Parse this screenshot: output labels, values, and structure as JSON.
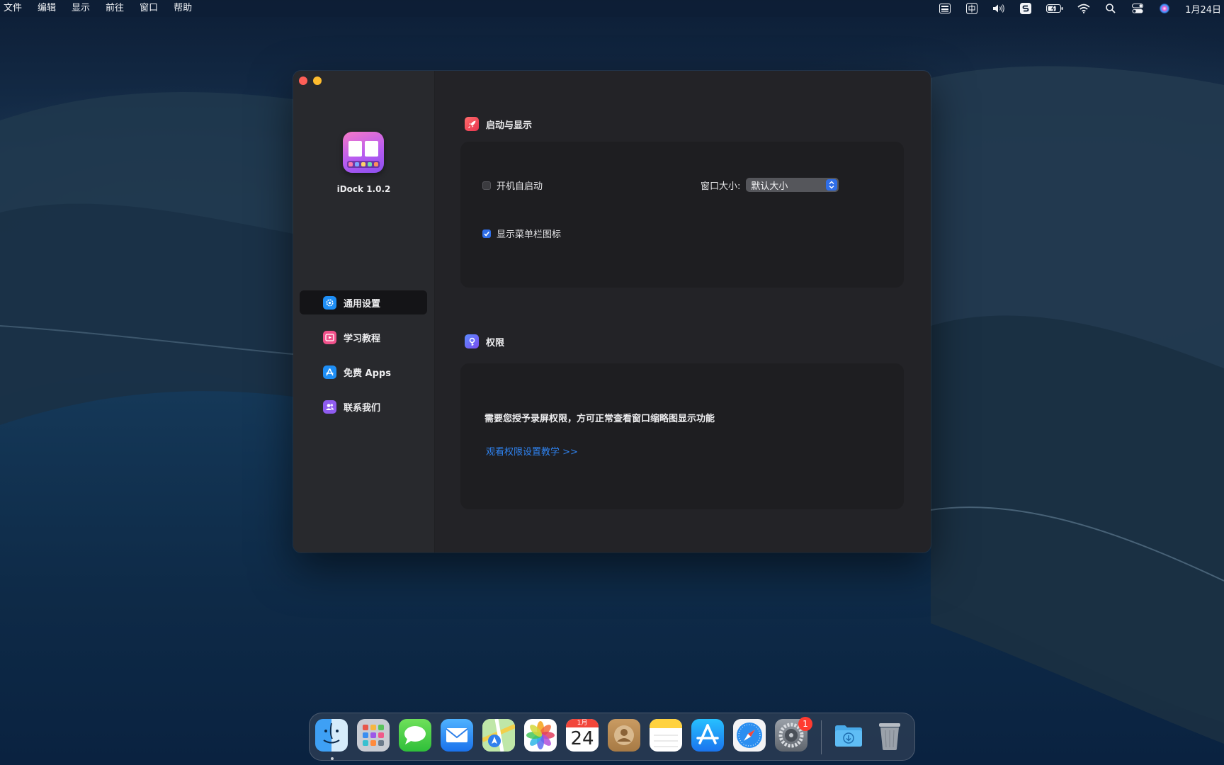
{
  "menubar": {
    "items": [
      "文件",
      "编辑",
      "显示",
      "前往",
      "窗口",
      "帮助"
    ],
    "status_icons": [
      "keyboard-grid-icon",
      "input-method-icon",
      "volume-icon",
      "sogou-icon",
      "battery-icon",
      "wifi-icon",
      "spotlight-search-icon",
      "control-center-icon",
      "siri-icon"
    ],
    "clock": "1月24日"
  },
  "window": {
    "app_name": "iDock 1.0.2",
    "nav": [
      {
        "label": "通用设置",
        "icon": "gear-icon",
        "active": true,
        "color": "#1e8ef5"
      },
      {
        "label": "学习教程",
        "icon": "tutorial-icon",
        "active": false,
        "color": "#f0508a"
      },
      {
        "label": "免费 Apps",
        "icon": "app-store-icon",
        "active": false,
        "color": "#1e8ef5"
      },
      {
        "label": "联系我们",
        "icon": "contacts-icon",
        "active": false,
        "color": "#8f5cf0"
      }
    ],
    "sections": {
      "launch": {
        "title": "启动与显示",
        "icon": "rocket-icon",
        "launch_at_login": {
          "label": "开机自启动",
          "checked": false
        },
        "window_size": {
          "label": "窗口大小:",
          "value": "默认大小"
        },
        "show_menubar_icon": {
          "label": "显示菜单栏图标",
          "checked": true
        }
      },
      "permissions": {
        "title": "权限",
        "icon": "key-icon",
        "message": "需要您授予录屏权限，方可正常查看窗口缩略图显示功能",
        "link": "观看权限设置教学 >>"
      }
    }
  },
  "dock": {
    "apps": [
      "finder-icon",
      "launchpad-icon",
      "messages-icon",
      "mail-icon",
      "maps-icon",
      "photos-icon",
      "calendar-icon",
      "contacts-icon",
      "notes-icon",
      "app-store-icon",
      "safari-icon",
      "system-preferences-icon",
      "downloads-folder-icon",
      "trash-icon"
    ],
    "calendar_month": "1月",
    "calendar_day": "24",
    "system_prefs_badge": "1"
  },
  "colors": {
    "accent": "#2f6ee8",
    "link": "#2f82ee",
    "window_bg": "#232327",
    "sidebar_bg": "#28292d"
  }
}
